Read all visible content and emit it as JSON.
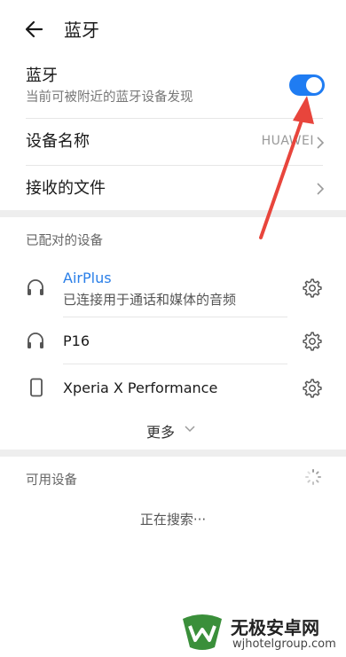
{
  "header": {
    "title": "蓝牙"
  },
  "bluetooth": {
    "label": "蓝牙",
    "subtitle": "当前可被附近的蓝牙设备发现",
    "enabled": true
  },
  "device_name": {
    "label": "设备名称",
    "value": "HUAWEI"
  },
  "received_files": {
    "label": "接收的文件"
  },
  "paired": {
    "section_label": "已配对的设备",
    "devices": [
      {
        "name": "AirPlus",
        "subtitle": "已连接用于通话和媒体的音频",
        "icon": "headphones-icon"
      },
      {
        "name": "P16",
        "subtitle": "",
        "icon": "headphones-icon"
      },
      {
        "name": "Xperia X Performance",
        "subtitle": "",
        "icon": "phone-icon"
      }
    ],
    "more_label": "更多"
  },
  "available": {
    "section_label": "可用设备",
    "searching_text": "正在搜索···"
  },
  "watermark": {
    "brand": "无极安卓网",
    "url": "wjhotelgroup.com"
  },
  "colors": {
    "accent": "#1f7cf2",
    "arrow": "#e8453c"
  }
}
